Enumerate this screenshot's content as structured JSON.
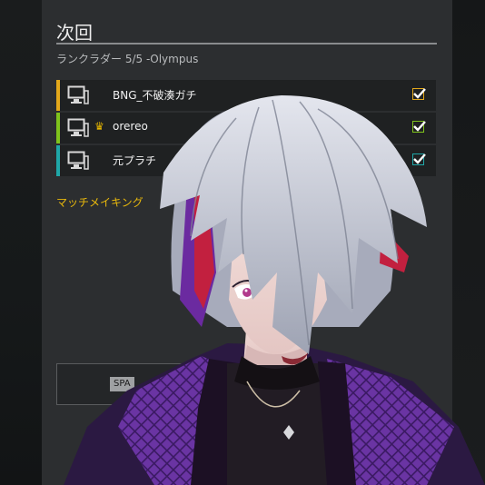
{
  "panel": {
    "title": "次回",
    "subtitle": "ランクラダー 5/5 -Olympus",
    "rows": [
      {
        "name": "BNG_不破湊ガチ",
        "accent": "#e3a81b",
        "crown": "",
        "checked": true
      },
      {
        "name": "orereo",
        "accent": "#7fc31c",
        "crown": "♛",
        "checked": true
      },
      {
        "name": "元プラチ",
        "accent": "#1fa7a8",
        "crown": "",
        "checked": true
      }
    ],
    "matchmaking_label": "マッチメイキング",
    "spa_button_label": "SPA"
  },
  "colors": {
    "panel_bg": "#2c2e30",
    "row_bg": "#1f2122",
    "accent_gold": "#e8b80c",
    "hair": "#c9cdd6",
    "jacket": "#5b2c8c"
  },
  "icons": [
    "computer-icon",
    "crown-icon",
    "checkbox-checked-icon"
  ]
}
